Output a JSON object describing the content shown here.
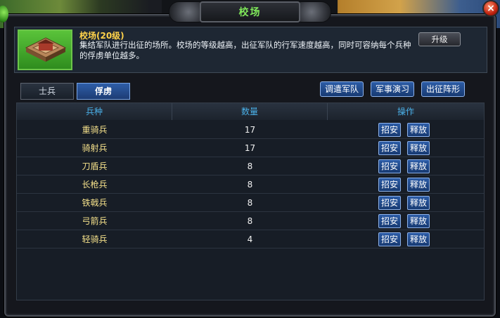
{
  "window": {
    "title": "校场",
    "close_symbol": "×"
  },
  "building": {
    "name": "校场(20级)",
    "description": "集结军队进行出征的场所。校场的等级越高，出征军队的行军速度越高，同时可容纳每个兵种的俘虏单位越多。",
    "upgrade_label": "升级"
  },
  "tabs": [
    {
      "label": "士兵",
      "active": false
    },
    {
      "label": "俘虏",
      "active": true
    }
  ],
  "actions": {
    "dispatch_label": "调遣军队",
    "drill_label": "军事演习",
    "formation_label": "出征阵形"
  },
  "table": {
    "headers": {
      "type": "兵种",
      "count": "数量",
      "ops": "操作"
    },
    "recruit_label": "招安",
    "release_label": "释放",
    "rows": [
      {
        "type": "重骑兵",
        "count": "17"
      },
      {
        "type": "骑射兵",
        "count": "17"
      },
      {
        "type": "刀盾兵",
        "count": "8"
      },
      {
        "type": "长枪兵",
        "count": "8"
      },
      {
        "type": "铁戟兵",
        "count": "8"
      },
      {
        "type": "弓箭兵",
        "count": "8"
      },
      {
        "type": "轻骑兵",
        "count": "4"
      }
    ]
  },
  "colors": {
    "title": "#7fe85a",
    "building_name": "#ffd24a",
    "header": "#4ab0e8",
    "unit_name": "#f4e08a"
  }
}
